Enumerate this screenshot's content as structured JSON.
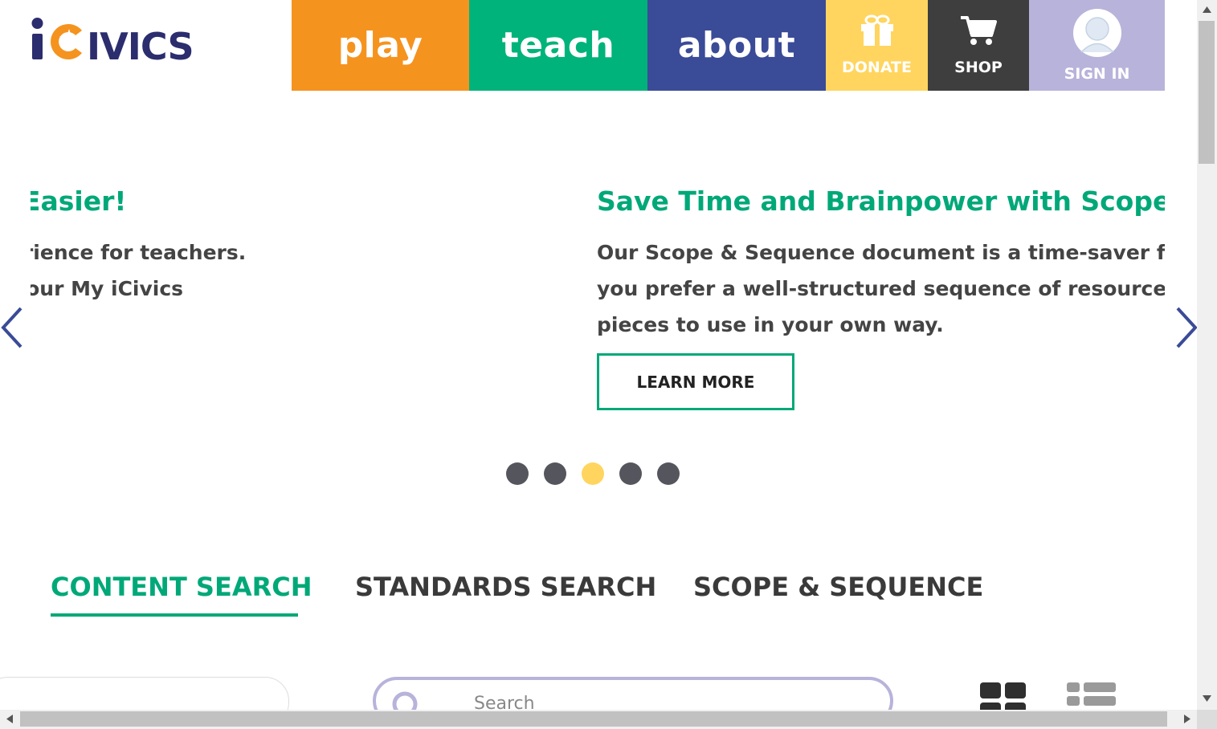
{
  "brand": {
    "logo_text": "iCivics",
    "colors": {
      "navy": "#2b2d6e",
      "orange": "#f5931f",
      "green": "#00b37a"
    }
  },
  "nav": {
    "play": "play",
    "teach": "teach",
    "about": "about",
    "donate": "DONATE",
    "shop": "SHOP",
    "sign_in": "SIGN IN",
    "icons": {
      "donate": "gift-icon",
      "shop": "cart-icon",
      "sign_in": "user-avatar-icon"
    }
  },
  "slider": {
    "prev_slide": {
      "title": "ot Easier!",
      "line1": "xperience for teachers.",
      "line2": "to your My iCivics"
    },
    "current_slide": {
      "title": "Save Time and Brainpower with Scope & S",
      "line1": "Our Scope & Sequence document is a time-saver for a",
      "line2": "you prefer a well-structured sequence of resources o",
      "line3": "pieces to use in your own way.",
      "button": "LEARN MORE"
    },
    "dot_count": 5,
    "active_dot": 3
  },
  "tabs": {
    "content_search": "CONTENT SEARCH",
    "standards_search": "STANDARDS SEARCH",
    "scope_sequence": "SCOPE & SEQUENCE",
    "active": "content_search"
  },
  "search": {
    "placeholder": "Search"
  },
  "view_toggle": {
    "grid": "grid-view-icon",
    "list": "list-view-icon"
  }
}
